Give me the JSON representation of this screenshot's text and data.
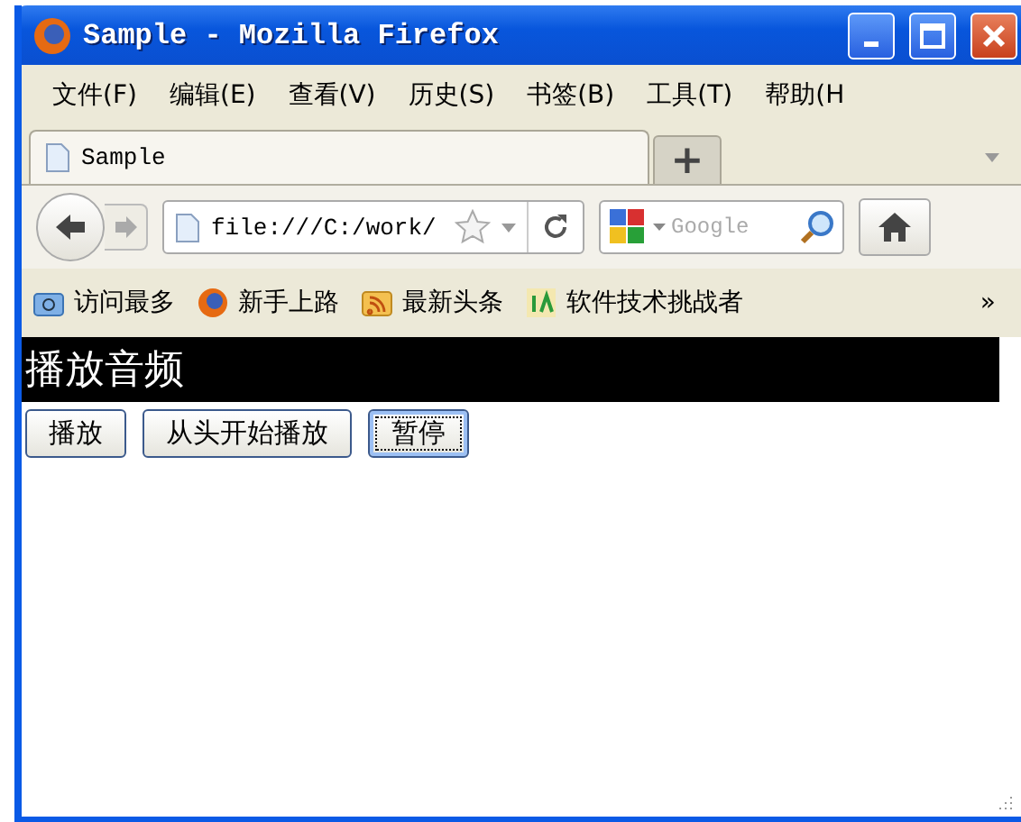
{
  "window": {
    "title": "Sample - Mozilla Firefox"
  },
  "menu": [
    "文件(F)",
    "编辑(E)",
    "查看(V)",
    "历史(S)",
    "书签(B)",
    "工具(T)",
    "帮助(H"
  ],
  "tabs": [
    {
      "label": "Sample",
      "selected": true
    }
  ],
  "new_tab": "+",
  "address": {
    "value": "file:///C:/work/"
  },
  "search": {
    "placeholder": "Google"
  },
  "bookmarks": [
    {
      "label": "访问最多",
      "kind": "folder"
    },
    {
      "label": "新手上路",
      "kind": "firefox"
    },
    {
      "label": "最新头条",
      "kind": "feed"
    },
    {
      "label": "软件技术挑战者",
      "kind": "site"
    }
  ],
  "bookmarks_more": "»",
  "page": {
    "heading": "播放音频",
    "buttons": [
      {
        "label": "播放",
        "focused": false
      },
      {
        "label": "从头开始播放",
        "focused": false
      },
      {
        "label": "暂停",
        "focused": true
      }
    ]
  }
}
